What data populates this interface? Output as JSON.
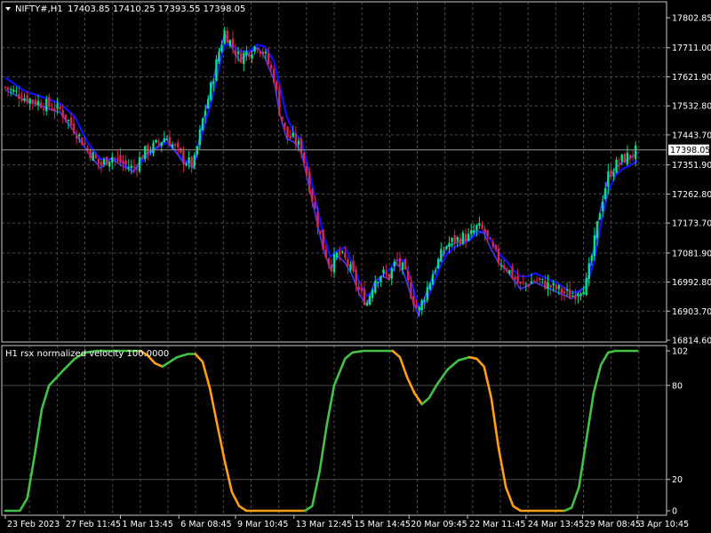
{
  "window": {
    "title": "NIFTY#,H1",
    "ohlc": "17403.85 17410.25 17393.55 17398.05"
  },
  "indicator": {
    "title": "H1 rsx normalized velocity 100.0000"
  },
  "colors": {
    "background": "#000000",
    "grid": "#4a4a4a",
    "frame": "#c8c8c8",
    "bull": "#00e08a",
    "bear": "#d6284a",
    "ma": "#1010ff",
    "ma_fast": "#3a3aff",
    "osc_up": "#45c245",
    "osc_down": "#ffa012",
    "current_price_line": "#9a9a9a"
  },
  "chart_data": [
    {
      "type": "candlestick",
      "name": "NIFTY#,H1",
      "current_price": 17398.05,
      "current_price_label": "17398.05",
      "ylim": [
        16814.6,
        17850
      ],
      "yticks": [
        17802.85,
        17711.0,
        17621.9,
        17532.8,
        17443.7,
        17351.9,
        17262.8,
        17173.7,
        17081.9,
        16992.8,
        16903.7,
        16814.6
      ],
      "ytick_labels": [
        "17802.85",
        "17711.00",
        "17621.90",
        "17532.80",
        "17443.70",
        "17351.90",
        "17262.80",
        "17173.70",
        "17081.90",
        "16992.80",
        "16903.70",
        "16814.60"
      ],
      "close_path": [
        [
          0,
          17590
        ],
        [
          10,
          17560
        ],
        [
          20,
          17540
        ],
        [
          30,
          17520
        ],
        [
          38,
          17460
        ],
        [
          45,
          17400
        ],
        [
          52,
          17350
        ],
        [
          58,
          17380
        ],
        [
          63,
          17360
        ],
        [
          70,
          17340
        ],
        [
          76,
          17390
        ],
        [
          82,
          17410
        ],
        [
          88,
          17440
        ],
        [
          92,
          17410
        ],
        [
          97,
          17370
        ],
        [
          103,
          17350
        ],
        [
          108,
          17490
        ],
        [
          113,
          17600
        ],
        [
          117,
          17700
        ],
        [
          120,
          17760
        ],
        [
          124,
          17720
        ],
        [
          128,
          17680
        ],
        [
          133,
          17700
        ],
        [
          138,
          17720
        ],
        [
          142,
          17690
        ],
        [
          147,
          17620
        ],
        [
          150,
          17520
        ],
        [
          154,
          17440
        ],
        [
          158,
          17430
        ],
        [
          162,
          17400
        ],
        [
          166,
          17300
        ],
        [
          170,
          17200
        ],
        [
          174,
          17100
        ],
        [
          178,
          17040
        ],
        [
          182,
          17080
        ],
        [
          186,
          17060
        ],
        [
          190,
          17020
        ],
        [
          194,
          16960
        ],
        [
          198,
          16930
        ],
        [
          202,
          17000
        ],
        [
          206,
          17020
        ],
        [
          210,
          17010
        ],
        [
          214,
          17060
        ],
        [
          218,
          17030
        ],
        [
          222,
          16960
        ],
        [
          226,
          16900
        ],
        [
          230,
          16960
        ],
        [
          234,
          17020
        ],
        [
          238,
          17070
        ],
        [
          242,
          17110
        ],
        [
          246,
          17120
        ],
        [
          250,
          17130
        ],
        [
          254,
          17130
        ],
        [
          258,
          17160
        ],
        [
          262,
          17150
        ],
        [
          266,
          17100
        ],
        [
          270,
          17060
        ],
        [
          274,
          17040
        ],
        [
          278,
          17010
        ],
        [
          282,
          16980
        ],
        [
          286,
          16990
        ],
        [
          290,
          17000
        ],
        [
          294,
          16990
        ],
        [
          298,
          16980
        ],
        [
          302,
          16970
        ],
        [
          306,
          16960
        ],
        [
          310,
          16950
        ],
        [
          314,
          16970
        ],
        [
          318,
          16990
        ],
        [
          322,
          17100
        ],
        [
          326,
          17230
        ],
        [
          330,
          17320
        ],
        [
          334,
          17350
        ],
        [
          338,
          17370
        ],
        [
          342,
          17380
        ],
        [
          346,
          17398.05
        ]
      ],
      "ma": {
        "name": "",
        "values": [
          [
            0,
            17620
          ],
          [
            10,
            17580
          ],
          [
            20,
            17560
          ],
          [
            30,
            17540
          ],
          [
            38,
            17500
          ],
          [
            45,
            17420
          ],
          [
            52,
            17370
          ],
          [
            58,
            17370
          ],
          [
            63,
            17365
          ],
          [
            70,
            17330
          ],
          [
            76,
            17370
          ],
          [
            82,
            17400
          ],
          [
            88,
            17420
          ],
          [
            92,
            17400
          ],
          [
            97,
            17370
          ],
          [
            103,
            17350
          ],
          [
            108,
            17450
          ],
          [
            113,
            17550
          ],
          [
            117,
            17650
          ],
          [
            120,
            17720
          ],
          [
            124,
            17720
          ],
          [
            128,
            17700
          ],
          [
            133,
            17700
          ],
          [
            138,
            17720
          ],
          [
            142,
            17715
          ],
          [
            147,
            17670
          ],
          [
            150,
            17600
          ],
          [
            154,
            17500
          ],
          [
            158,
            17450
          ],
          [
            162,
            17430
          ],
          [
            166,
            17340
          ],
          [
            170,
            17240
          ],
          [
            174,
            17140
          ],
          [
            178,
            17070
          ],
          [
            182,
            17090
          ],
          [
            186,
            17100
          ],
          [
            190,
            17050
          ],
          [
            194,
            16990
          ],
          [
            198,
            16950
          ],
          [
            202,
            16970
          ],
          [
            206,
            17010
          ],
          [
            210,
            17030
          ],
          [
            214,
            17060
          ],
          [
            218,
            17060
          ],
          [
            222,
            17000
          ],
          [
            226,
            16920
          ],
          [
            230,
            16930
          ],
          [
            234,
            16980
          ],
          [
            238,
            17040
          ],
          [
            242,
            17080
          ],
          [
            246,
            17100
          ],
          [
            250,
            17110
          ],
          [
            254,
            17120
          ],
          [
            258,
            17140
          ],
          [
            262,
            17150
          ],
          [
            266,
            17120
          ],
          [
            270,
            17080
          ],
          [
            274,
            17060
          ],
          [
            278,
            17030
          ],
          [
            282,
            17010
          ],
          [
            286,
            17010
          ],
          [
            290,
            17020
          ],
          [
            294,
            17010
          ],
          [
            298,
            17000
          ],
          [
            302,
            16990
          ],
          [
            306,
            16975
          ],
          [
            310,
            16960
          ],
          [
            314,
            16965
          ],
          [
            318,
            16980
          ],
          [
            322,
            17050
          ],
          [
            326,
            17170
          ],
          [
            330,
            17270
          ],
          [
            334,
            17320
          ],
          [
            338,
            17340
          ],
          [
            342,
            17350
          ],
          [
            346,
            17365
          ]
        ]
      },
      "xtick_labels": [
        "23 Feb 2023",
        "27 Feb 11:45",
        "1 Mar 13:45",
        "6 Mar 08:45",
        "9 Mar 10:45",
        "13 Mar 12:45",
        "15 Mar 14:45",
        "20 Mar 09:45",
        "22 Mar 11:45",
        "24 Mar 13:45",
        "29 Mar 08:45",
        "3 Apr 10:45"
      ],
      "xtick_positions": [
        0,
        32,
        63,
        95,
        126,
        158,
        190,
        221,
        253,
        285,
        316,
        346
      ],
      "xlim": [
        0,
        360
      ]
    },
    {
      "type": "line",
      "name": "H1 rsx normalized velocity 100.0000",
      "ylim": [
        0,
        102
      ],
      "yticks": [
        102,
        80,
        20,
        0
      ],
      "ytick_labels": [
        "102",
        "80",
        "20",
        "0"
      ],
      "values": [
        [
          0,
          0
        ],
        [
          8,
          0
        ],
        [
          12,
          8
        ],
        [
          16,
          35
        ],
        [
          20,
          65
        ],
        [
          24,
          80
        ],
        [
          28,
          85
        ],
        [
          32,
          90
        ],
        [
          38,
          97
        ],
        [
          44,
          101
        ],
        [
          50,
          102
        ],
        [
          56,
          102
        ],
        [
          62,
          102
        ],
        [
          68,
          102
        ],
        [
          74,
          102
        ],
        [
          78,
          99
        ],
        [
          82,
          94
        ],
        [
          86,
          92
        ],
        [
          90,
          95
        ],
        [
          94,
          98
        ],
        [
          100,
          100
        ],
        [
          104,
          100
        ],
        [
          108,
          95
        ],
        [
          112,
          78
        ],
        [
          116,
          55
        ],
        [
          120,
          32
        ],
        [
          124,
          12
        ],
        [
          128,
          3
        ],
        [
          132,
          0
        ],
        [
          140,
          0
        ],
        [
          150,
          0
        ],
        [
          158,
          0
        ],
        [
          164,
          0
        ],
        [
          168,
          3
        ],
        [
          172,
          25
        ],
        [
          176,
          55
        ],
        [
          180,
          80
        ],
        [
          186,
          97
        ],
        [
          190,
          101
        ],
        [
          196,
          102
        ],
        [
          204,
          102
        ],
        [
          212,
          102
        ],
        [
          216,
          98
        ],
        [
          220,
          85
        ],
        [
          224,
          75
        ],
        [
          228,
          68
        ],
        [
          232,
          72
        ],
        [
          236,
          80
        ],
        [
          242,
          90
        ],
        [
          248,
          96
        ],
        [
          254,
          98
        ],
        [
          258,
          97
        ],
        [
          262,
          92
        ],
        [
          266,
          72
        ],
        [
          270,
          40
        ],
        [
          274,
          15
        ],
        [
          278,
          3
        ],
        [
          282,
          0
        ],
        [
          290,
          0
        ],
        [
          300,
          0
        ],
        [
          306,
          0
        ],
        [
          310,
          2
        ],
        [
          314,
          15
        ],
        [
          318,
          45
        ],
        [
          322,
          75
        ],
        [
          326,
          93
        ],
        [
          330,
          101
        ],
        [
          334,
          102
        ],
        [
          340,
          102
        ],
        [
          346,
          102
        ]
      ],
      "color_segments": [
        {
          "from": 0,
          "to": 74,
          "trend": "up"
        },
        {
          "from": 74,
          "to": 86,
          "trend": "down"
        },
        {
          "from": 86,
          "to": 104,
          "trend": "up"
        },
        {
          "from": 104,
          "to": 164,
          "trend": "down"
        },
        {
          "from": 164,
          "to": 212,
          "trend": "up"
        },
        {
          "from": 212,
          "to": 228,
          "trend": "down"
        },
        {
          "from": 228,
          "to": 254,
          "trend": "up"
        },
        {
          "from": 254,
          "to": 306,
          "trend": "down"
        },
        {
          "from": 306,
          "to": 346,
          "trend": "up"
        }
      ],
      "xlim": [
        0,
        360
      ]
    }
  ]
}
